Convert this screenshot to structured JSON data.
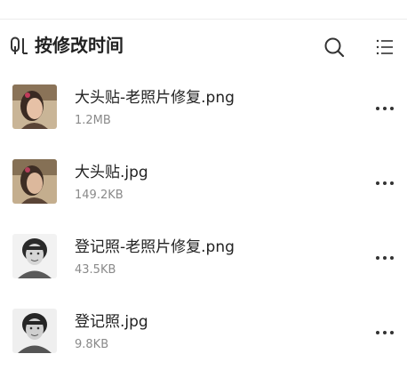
{
  "toolbar": {
    "sort_label": "按修改时间",
    "sort_icon": "sort-icon",
    "search_icon": "search-icon",
    "view_icon": "list-view-icon"
  },
  "files": [
    {
      "name": "大头贴-老照片修复.png",
      "size": "1.2MB",
      "thumb": "color-portrait"
    },
    {
      "name": "大头贴.jpg",
      "size": "149.2KB",
      "thumb": "color-portrait"
    },
    {
      "name": "登记照-老照片修复.png",
      "size": "43.5KB",
      "thumb": "bw-portrait"
    },
    {
      "name": "登记照.jpg",
      "size": "9.8KB",
      "thumb": "bw-portrait"
    }
  ],
  "colors": {
    "text_primary": "#222222",
    "text_secondary": "#8a8a8a",
    "icon": "#333333",
    "divider": "#ececec"
  }
}
